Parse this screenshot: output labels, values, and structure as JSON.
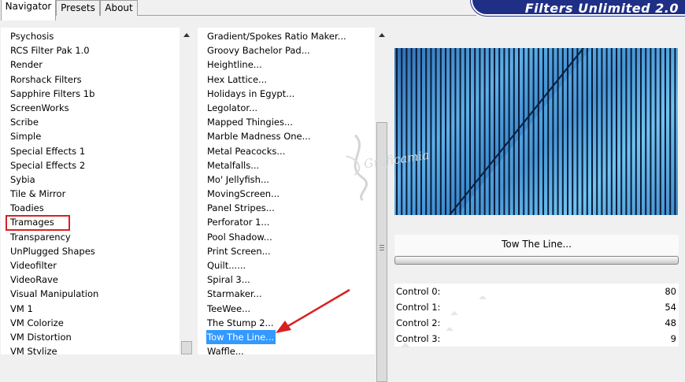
{
  "tabs": [
    "Navigator",
    "Presets",
    "About"
  ],
  "banner": {
    "title": "Filters Unlimited 2.0"
  },
  "categories": {
    "items": [
      "Psychosis",
      "RCS Filter Pak 1.0",
      "Render",
      "Rorshack Filters",
      "Sapphire Filters 1b",
      "ScreenWorks",
      "Scribe",
      "Simple",
      "Special Effects 1",
      "Special Effects 2",
      "Sybia",
      "Tile & Mirror",
      "Toadies",
      "Tramages",
      "Transparency",
      "UnPlugged Shapes",
      "Videofilter",
      "VideoRave",
      "Visual Manipulation",
      "VM 1",
      "VM Colorize",
      "VM Distortion",
      "VM Stylize"
    ],
    "highlighted": "Tramages"
  },
  "filters": {
    "items": [
      "Gradient/Spokes Ratio Maker...",
      "Groovy Bachelor Pad...",
      "Heightline...",
      "Hex Lattice...",
      "Holidays in Egypt...",
      "Legolator...",
      "Mapped Thingies...",
      "Marble Madness One...",
      "Metal Peacocks...",
      "Metalfalls...",
      "Mo' Jellyfish...",
      "MovingScreen...",
      "Panel Stripes...",
      "Perforator 1...",
      "Pool Shadow...",
      "Print Screen...",
      "Quilt......",
      "Spiral 3...",
      "Starmaker...",
      "TeeWee...",
      "The Stump 2...",
      "Tow The Line...",
      "Waffle..."
    ],
    "selected": "Tow The Line..."
  },
  "preview": {
    "filter_name": "Tow The Line..."
  },
  "controls": [
    {
      "label": "Control 0:",
      "value": "80"
    },
    {
      "label": "Control 1:",
      "value": "54"
    },
    {
      "label": "Control 2:",
      "value": "48"
    },
    {
      "label": "Control 3:",
      "value": "9"
    }
  ],
  "watermark": "Graficamia",
  "colors": {
    "selection": "#3399ff",
    "annotation": "#d92020",
    "banner": "#1f2f86"
  }
}
